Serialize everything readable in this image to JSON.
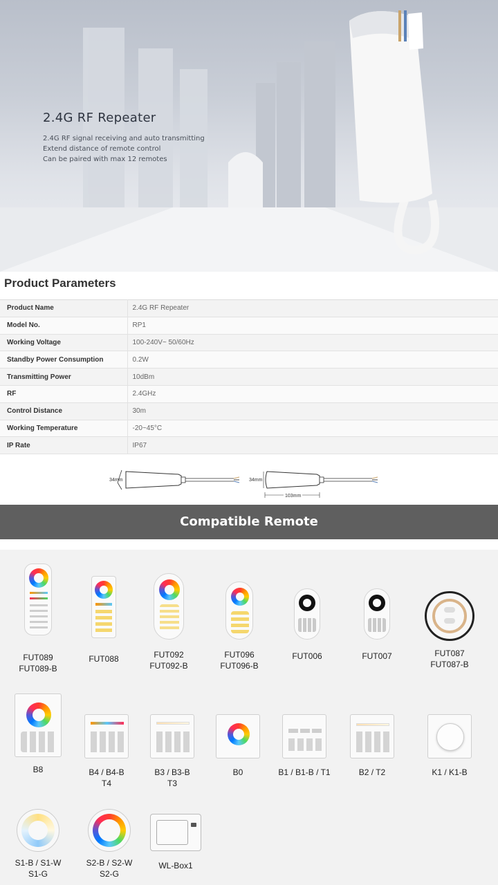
{
  "hero": {
    "title": "2.4G RF Repeater",
    "lines": [
      "2.4G RF signal receiving and auto transmitting",
      "Extend distance of remote control",
      "Can be paired with max 12 remotes"
    ]
  },
  "parameters": {
    "title": "Product Parameters",
    "rows": [
      {
        "label": "Product Name",
        "value": "2.4G RF Repeater"
      },
      {
        "label": "Model No.",
        "value": "RP1"
      },
      {
        "label": "Working Voltage",
        "value": "100-240V~ 50/60Hz"
      },
      {
        "label": "Standby Power Consumption",
        "value": "0.2W"
      },
      {
        "label": "Transmitting Power",
        "value": "10dBm"
      },
      {
        "label": "RF",
        "value": "2.4GHz"
      },
      {
        "label": "Control Distance",
        "value": "30m"
      },
      {
        "label": "Working Temperature",
        "value": "-20~45°C"
      },
      {
        "label": "IP Rate",
        "value": "IP67"
      }
    ]
  },
  "dimensions": {
    "height_left": "34mm",
    "height_right": "34mm",
    "length": "103mm"
  },
  "compatible": {
    "title": "Compatible Remote",
    "remotes": [
      {
        "line1": "FUT089",
        "line2": "FUT089-B"
      },
      {
        "line1": "FUT088",
        "line2": ""
      },
      {
        "line1": "FUT092",
        "line2": "FUT092-B"
      },
      {
        "line1": "FUT096",
        "line2": "FUT096-B"
      },
      {
        "line1": "FUT006",
        "line2": ""
      },
      {
        "line1": "FUT007",
        "line2": ""
      },
      {
        "line1": "FUT087",
        "line2": "FUT087-B"
      },
      {
        "line1": "B8",
        "line2": ""
      },
      {
        "line1": "B4 / B4-B",
        "line2": "T4"
      },
      {
        "line1": "B3 / B3-B",
        "line2": "T3"
      },
      {
        "line1": "B0",
        "line2": ""
      },
      {
        "line1": "B1 / B1-B / T1",
        "line2": ""
      },
      {
        "line1": "B2 / T2",
        "line2": ""
      },
      {
        "line1": "K1 / K1-B",
        "line2": ""
      },
      {
        "line1": "S1-B / S1-W",
        "line2": "S1-G"
      },
      {
        "line1": "S2-B / S2-W",
        "line2": "S2-G"
      },
      {
        "line1": "WL-Box1",
        "line2": ""
      }
    ]
  }
}
